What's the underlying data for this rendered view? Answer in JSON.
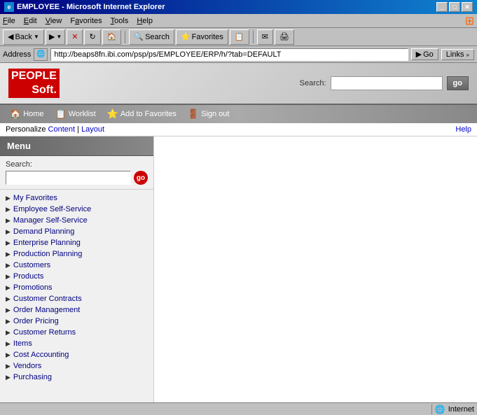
{
  "titleBar": {
    "title": "EMPLOYEE - Microsoft Internet Explorer",
    "icon": "IE"
  },
  "menuBar": {
    "items": [
      "File",
      "Edit",
      "View",
      "Favorites",
      "Tools",
      "Help"
    ]
  },
  "toolbar": {
    "back": "Back",
    "forward": "Forward",
    "stop": "Stop",
    "refresh": "Refresh",
    "home": "Home",
    "search": "Search",
    "favorites": "Favorites",
    "history": "History",
    "mail": "Mail",
    "print": "Print"
  },
  "addressBar": {
    "label": "Address",
    "url": "http://beaps8fn.ibi.com/psp/ps/EMPLOYEE/ERP/h/?tab=DEFAULT",
    "goLabel": "Go",
    "linksLabel": "Links"
  },
  "header": {
    "logoLine1": "PEOPLE",
    "logoLine2": "Soft.",
    "searchLabel": "Search:",
    "goLabel": "go",
    "searchPlaceholder": ""
  },
  "navbar": {
    "items": [
      {
        "label": "Home",
        "icon": "🏠"
      },
      {
        "label": "Worklist",
        "icon": "📋"
      },
      {
        "label": "Add to Favorites",
        "icon": "⭐"
      },
      {
        "label": "Sign out",
        "icon": "🚪"
      }
    ]
  },
  "personalizeBar": {
    "prefix": "Personalize",
    "content": "Content",
    "separator": "|",
    "layout": "Layout",
    "help": "Help"
  },
  "sidebar": {
    "title": "Menu",
    "searchLabel": "Search:",
    "searchPlaceholder": "",
    "goLabel": "go",
    "menuItems": [
      "My Favorites",
      "Employee Self-Service",
      "Manager Self-Service",
      "Demand Planning",
      "Enterprise Planning",
      "Production Planning",
      "Customers",
      "Products",
      "Promotions",
      "Customer Contracts",
      "Order Management",
      "Order Pricing",
      "Customer Returns",
      "Items",
      "Cost Accounting",
      "Vendors",
      "Purchasing"
    ]
  },
  "statusBar": {
    "status": "",
    "zone": "Internet"
  }
}
